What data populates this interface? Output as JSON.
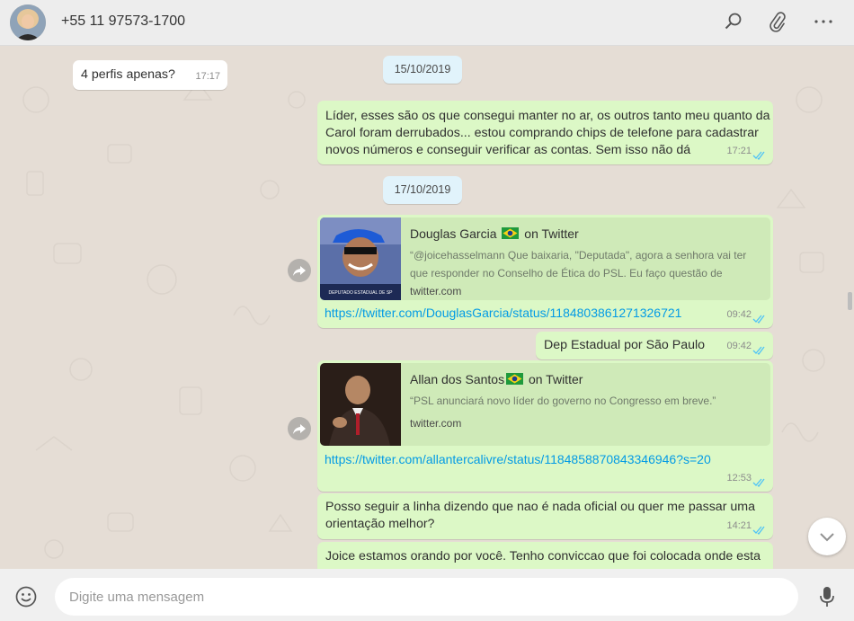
{
  "header": {
    "contact": "+55 11 97573-1700",
    "icons": [
      "search-icon",
      "attach-icon",
      "menu-icon"
    ]
  },
  "dates": [
    "15/10/2019",
    "17/10/2019"
  ],
  "messages": [
    {
      "dir": "in",
      "text": "4 perfis apenas?",
      "time": "17:17"
    },
    {
      "dir": "out",
      "lines": [
        "Líder, esses são os que consegui manter no ar, os outros tanto meu quanto da",
        "Carol foram derrubados... estou comprando chips de telefone para cadastrar",
        "novos números e conseguir verificar as contas. Sem isso não dá"
      ],
      "time": "17:21"
    },
    {
      "dir": "out",
      "preview": {
        "title_pre": "Douglas Garcia",
        "title_post": "on Twitter",
        "desc_lines": [
          "“@joicehasselmann Que baixaria, \"Deputada\", agora a senhora vai ter",
          "que responder no Conselho de Ética do PSL. Eu faço questão de"
        ],
        "domain": "twitter.com",
        "thumb_caption": "DEPUTADO ESTADUAL DE SP"
      },
      "link": "https://twitter.com/DouglasGarcia/status/1184803861271326721",
      "time": "09:42"
    },
    {
      "dir": "out",
      "text": "Dep Estadual por São Paulo",
      "time": "09:42"
    },
    {
      "dir": "out",
      "preview": {
        "title_pre": "Allan dos Santos",
        "title_post": "on Twitter",
        "desc_lines": [
          "“PSL anunciará novo líder do governo no Congresso em breve.”"
        ],
        "domain": "twitter.com"
      },
      "link": "https://twitter.com/allantercalivre/status/1184858870843346946?s=20",
      "time": "12:53"
    },
    {
      "dir": "out",
      "lines": [
        "Posso seguir a linha dizendo que nao é nada oficial ou quer me passar uma",
        "orientação melhor?"
      ],
      "time": "14:21"
    },
    {
      "dir": "out",
      "lines": [
        "Joice estamos orando por você. Tenho conviccao que foi colocada onde esta"
      ]
    }
  ],
  "composer": {
    "placeholder": "Digite uma mensagem"
  },
  "colors": {
    "outgoing": "#dcf8c6",
    "incoming": "#ffffff",
    "date_chip": "#e1f3fb",
    "link": "#039be5",
    "read_ticks": "#4fc3f7",
    "preview_bg": "#cfeab8"
  }
}
